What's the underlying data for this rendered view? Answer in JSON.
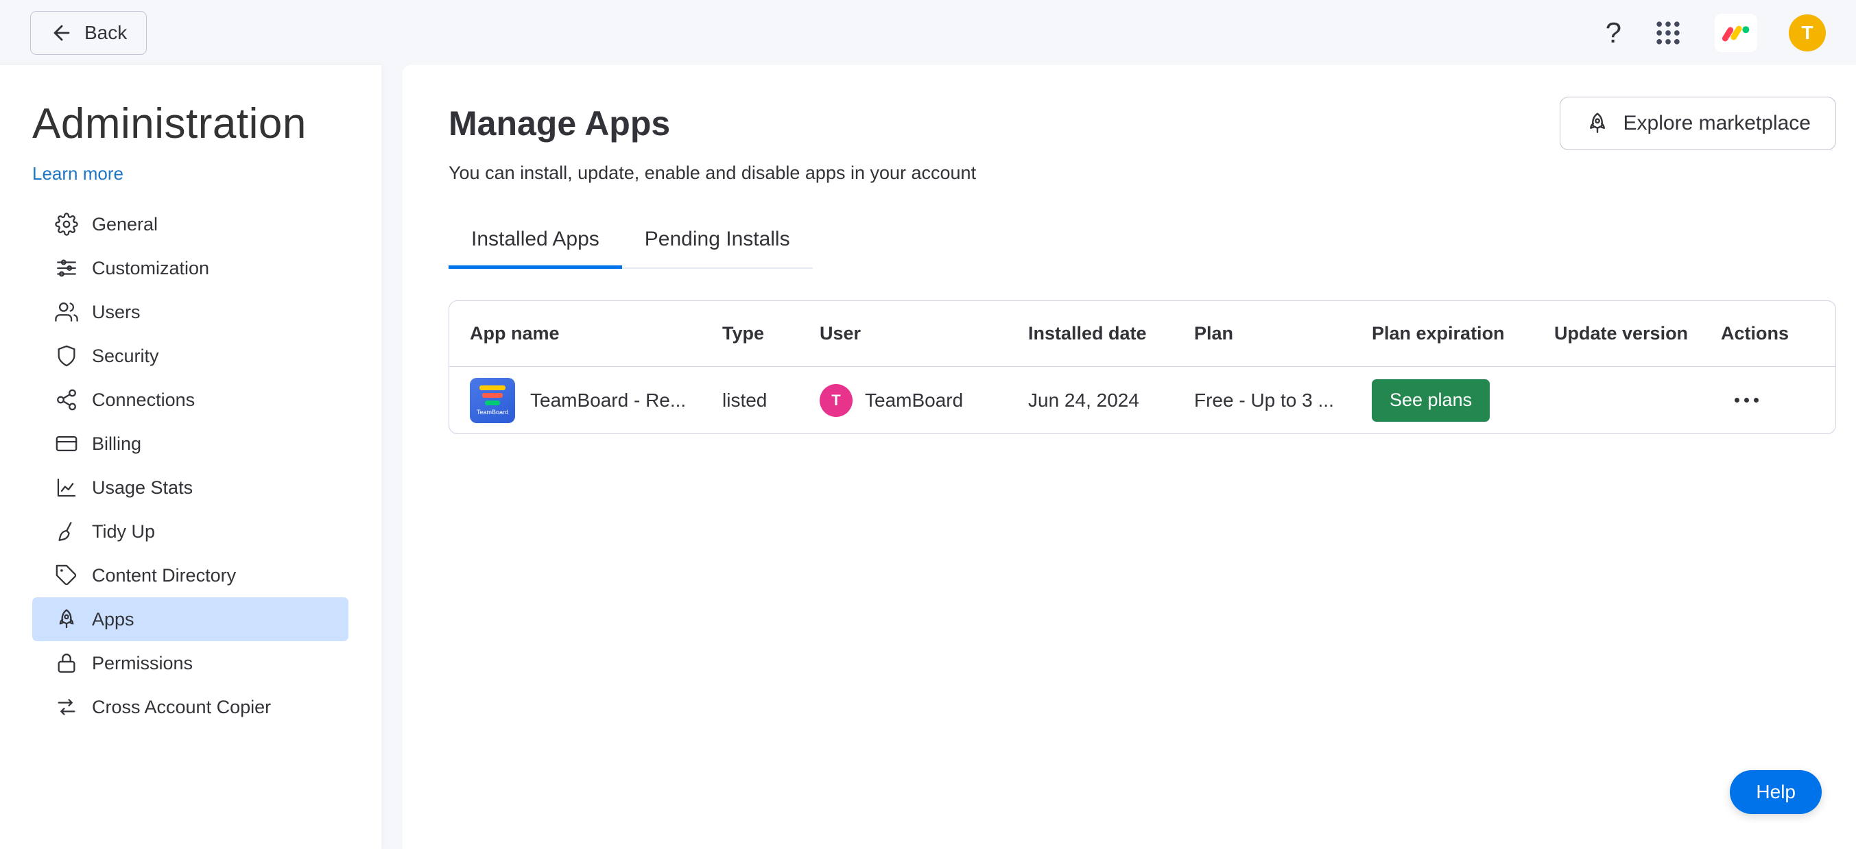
{
  "topbar": {
    "back_label": "Back",
    "question_glyph": "?",
    "avatar_letter": "T"
  },
  "sidebar": {
    "title": "Administration",
    "learn_more_label": "Learn more",
    "items": [
      {
        "label": "General",
        "icon": "gear"
      },
      {
        "label": "Customization",
        "icon": "sliders"
      },
      {
        "label": "Users",
        "icon": "users"
      },
      {
        "label": "Security",
        "icon": "shield"
      },
      {
        "label": "Connections",
        "icon": "share-nodes"
      },
      {
        "label": "Billing",
        "icon": "credit-card"
      },
      {
        "label": "Usage Stats",
        "icon": "line-chart"
      },
      {
        "label": "Tidy Up",
        "icon": "broom"
      },
      {
        "label": "Content Directory",
        "icon": "tag"
      },
      {
        "label": "Apps",
        "icon": "rocket",
        "selected": true
      },
      {
        "label": "Permissions",
        "icon": "lock"
      },
      {
        "label": "Cross Account Copier",
        "icon": "transfer-arrows"
      }
    ]
  },
  "main": {
    "title": "Manage Apps",
    "subtitle": "You can install, update, enable and disable apps in your account",
    "explore_button_label": "Explore marketplace",
    "tabs": [
      {
        "label": "Installed Apps",
        "active": true
      },
      {
        "label": "Pending Installs",
        "active": false
      }
    ],
    "table": {
      "columns": [
        "App name",
        "Type",
        "User",
        "Installed date",
        "Plan",
        "Plan expiration",
        "Update version",
        "Actions"
      ],
      "rows": [
        {
          "app_name": "TeamBoard - Re...",
          "app_icon_label": "TeamBoard",
          "type": "listed",
          "user_name": "TeamBoard",
          "user_avatar_letter": "T",
          "installed_date": "Jun 24, 2024",
          "plan": "Free - Up to 3 ...",
          "plan_expiration_action": "See plans",
          "update_version": "",
          "actions_icon": "ellipsis-menu"
        }
      ]
    }
  },
  "help_button_label": "Help",
  "colors": {
    "accent-blue": "#0073ea",
    "link-blue": "#1f76c2",
    "selected-bg": "#cce0ff",
    "green": "#258750",
    "pink-avatar": "#e8338c",
    "yellow-avatar": "#f5b400",
    "text": "#323338",
    "border": "#c3c6d4",
    "table-border": "#d0d4e4",
    "page-bg": "#f6f7fb"
  }
}
